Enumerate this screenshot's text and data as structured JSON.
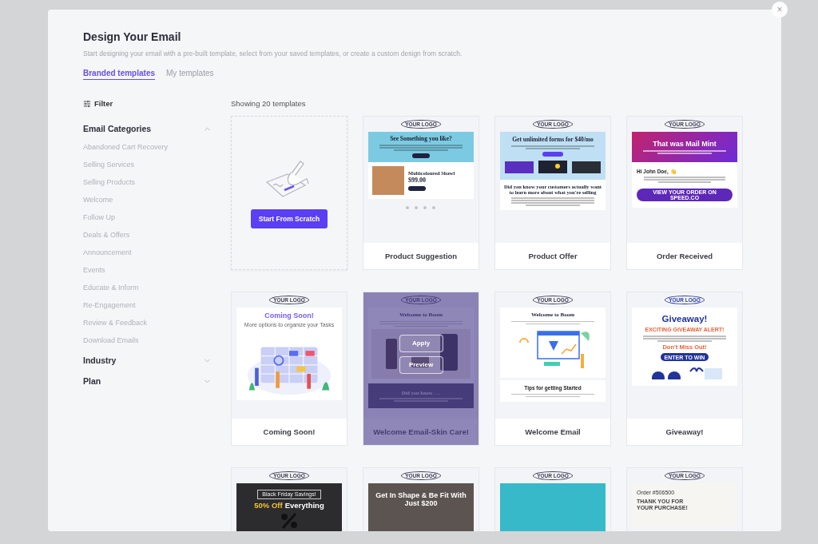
{
  "close_button": "×",
  "title": "Design Your Email",
  "subtitle": "Start designing your email with a pre-built template, select from your saved templates, or create a custom design from scratch.",
  "tabs": [
    {
      "label": "Branded templates",
      "selected": true
    },
    {
      "label": "My templates",
      "selected": false
    }
  ],
  "filter": {
    "label": "Filter"
  },
  "filter_groups": [
    {
      "title": "Email Categories",
      "expanded": true,
      "items": [
        "Abandoned Cart Recovery",
        "Selling Services",
        "Selling Products",
        "Welcome",
        "Follow Up",
        "Deals & Offers",
        "Announcement",
        "Events",
        "Educate & Inform",
        "Re-Engagement",
        "Review & Feedback",
        "Download Emails"
      ]
    },
    {
      "title": "Industry",
      "expanded": false
    },
    {
      "title": "Plan",
      "expanded": false
    }
  ],
  "count": "Showing 20 templates",
  "scratch": {
    "button": "Start From Scratch"
  },
  "templates": [
    {
      "name": "Product Suggestion",
      "hovered": false,
      "preview": {
        "kind": "product-suggestion",
        "logo": "YOUR LOGO",
        "heading": "See Something you like?",
        "product_name": "Multicoloured Shawl",
        "price": "$99.00"
      }
    },
    {
      "name": "Product Offer",
      "hovered": false,
      "preview": {
        "kind": "product-offer",
        "logo": "YOUR LOGO",
        "heading": "Get unlimited forms for $40/mo",
        "subheading": "Did you know your customers actually want to learn more about what you're selling"
      }
    },
    {
      "name": "Order Received",
      "hovered": false,
      "preview": {
        "kind": "order-received",
        "logo": "YOUR LOGO",
        "heading": "That was Mail Mint",
        "greeting": "Hi John Doe, 👋",
        "button": "VIEW YOUR ORDER ON SPEED.CO"
      }
    },
    {
      "name": "Coming Soon!",
      "hovered": false,
      "preview": {
        "kind": "coming-soon",
        "logo": "YOUR LOGO",
        "heading": "Coming Soon!",
        "subtitle": "More options to organize your Tasks"
      }
    },
    {
      "name": "Welcome Email-Skin Care!",
      "hovered": true,
      "actions": [
        "Apply",
        "Preview"
      ],
      "preview": {
        "kind": "skin-care",
        "logo": "YOUR LOGO",
        "heading": "Welcome to Boom",
        "footer_heading": "Did you know . . ."
      }
    },
    {
      "name": "Welcome Email",
      "hovered": false,
      "preview": {
        "kind": "welcome",
        "logo": "YOUR LOGO",
        "heading": "Welcome to Boom",
        "subheading": "Tips for getting Started"
      }
    },
    {
      "name": "Giveaway!",
      "hovered": false,
      "preview": {
        "kind": "giveaway",
        "logo": "YOUR LOGO",
        "heading": "Giveaway!",
        "tagline": "EXCITING GIVEAWAY ALERT!",
        "highlight": "Don't Miss Out!",
        "button": "ENTER TO WIN"
      }
    },
    {
      "hovered": false,
      "preview": {
        "kind": "black-friday",
        "logo": "YOUR LOGO",
        "badge": "Black Friday Savings!",
        "highlight": "50% Off",
        "heading": "Everything"
      }
    },
    {
      "hovered": false,
      "preview": {
        "kind": "fitness",
        "logo": "YOUR LOGO",
        "heading": "Get In Shape & Be Fit With Just $200"
      }
    },
    {
      "hovered": false,
      "preview": {
        "kind": "shopping",
        "logo": "YOUR LOGO"
      }
    },
    {
      "hovered": false,
      "preview": {
        "kind": "thank-you",
        "logo": "YOUR LOGO",
        "order": "Order #506500",
        "heading": "THANK YOU FOR YOUR PURCHASE!"
      }
    }
  ]
}
